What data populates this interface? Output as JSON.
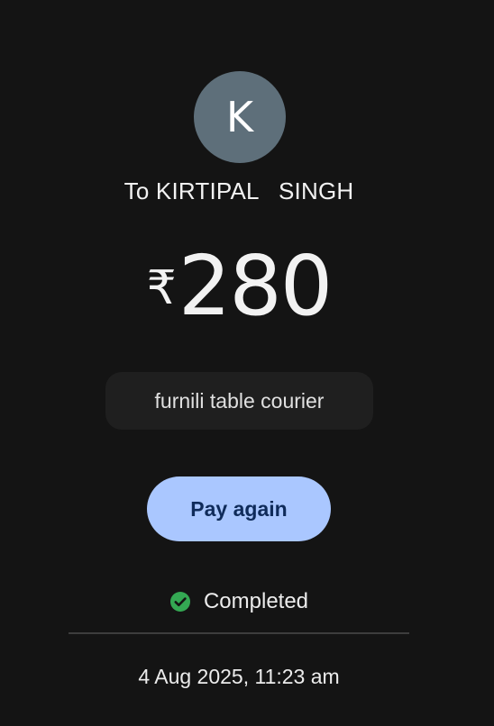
{
  "recipient": {
    "initial": "K",
    "label": "To KIRTIPAL   SINGH"
  },
  "payment": {
    "currency_symbol": "₹",
    "amount": "280",
    "note": "furnili table courier"
  },
  "actions": {
    "pay_again_label": "Pay again"
  },
  "status": {
    "text": "Completed",
    "icon": "check-circle-icon",
    "color": "#34a853"
  },
  "timestamp": "4 Aug 2025, 11:23 am",
  "colors": {
    "background": "#141414",
    "avatar": "#5e6f7a",
    "button": "#aac7ff",
    "button_text": "#0f2b5a",
    "note_bg": "#1f1f1f"
  }
}
